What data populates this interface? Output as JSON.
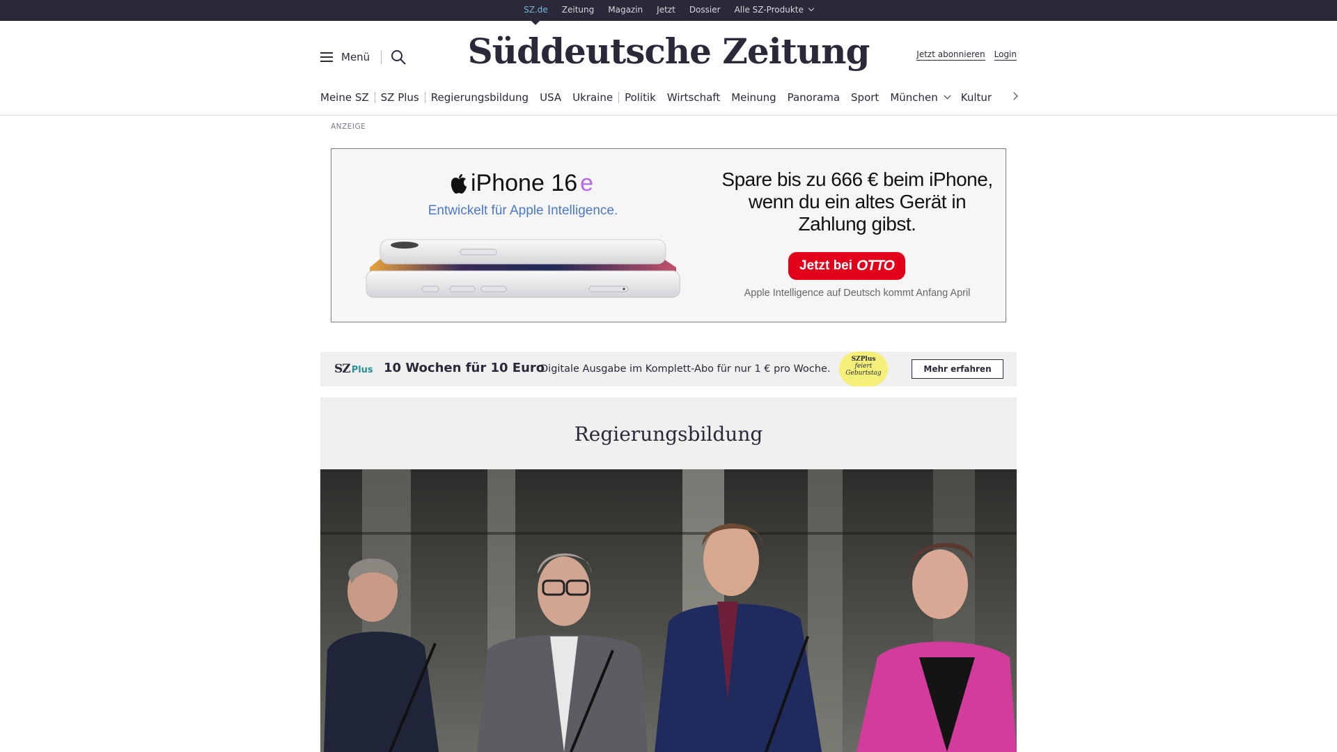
{
  "topbar": {
    "links": [
      "SZ.de",
      "Zeitung",
      "Magazin",
      "Jetzt",
      "Dossier",
      "Alle SZ-Produkte"
    ]
  },
  "header": {
    "menu_label": "Menü",
    "logo": "Süddeutsche Zeitung",
    "subscribe": "Jetzt abonnieren",
    "login": "Login"
  },
  "nav": {
    "items": [
      "Meine SZ",
      "SZ Plus",
      "Regierungsbildung",
      "USA",
      "Ukraine",
      "Politik",
      "Wirtschaft",
      "Meinung",
      "Panorama",
      "Sport",
      "München",
      "Kultur"
    ]
  },
  "ad": {
    "label": "ANZEIGE",
    "product": "iPhone 16",
    "product_suffix": "e",
    "subline": "Entwickelt für Apple Intelligence.",
    "headline": "Spare bis zu 666 € beim iPhone, wenn du ein altes Gerät in Zahlung gibst.",
    "cta_prefix": "Jetzt bei",
    "cta_brand": "OTTO",
    "note": "Apple Intelligence auf Deutsch kommt Anfang April"
  },
  "promo": {
    "logo_sz": "SZ",
    "logo_plus": "Plus",
    "title": "10 Wochen für 10 Euro",
    "text": "Digitale Ausgabe im Komplett-Abo für nur 1 € pro Woche.",
    "badge_line1": "SZPlus",
    "badge_line2": "feiert",
    "badge_line3": "Geburtstag",
    "button": "Mehr erfahren"
  },
  "topic": {
    "title": "Regierungsbildung"
  },
  "colors": {
    "topbar_bg": "#29293a",
    "active_link": "#7bb6d9",
    "ad_cta": "#e3001b",
    "promo_badge": "#f5f07a"
  }
}
